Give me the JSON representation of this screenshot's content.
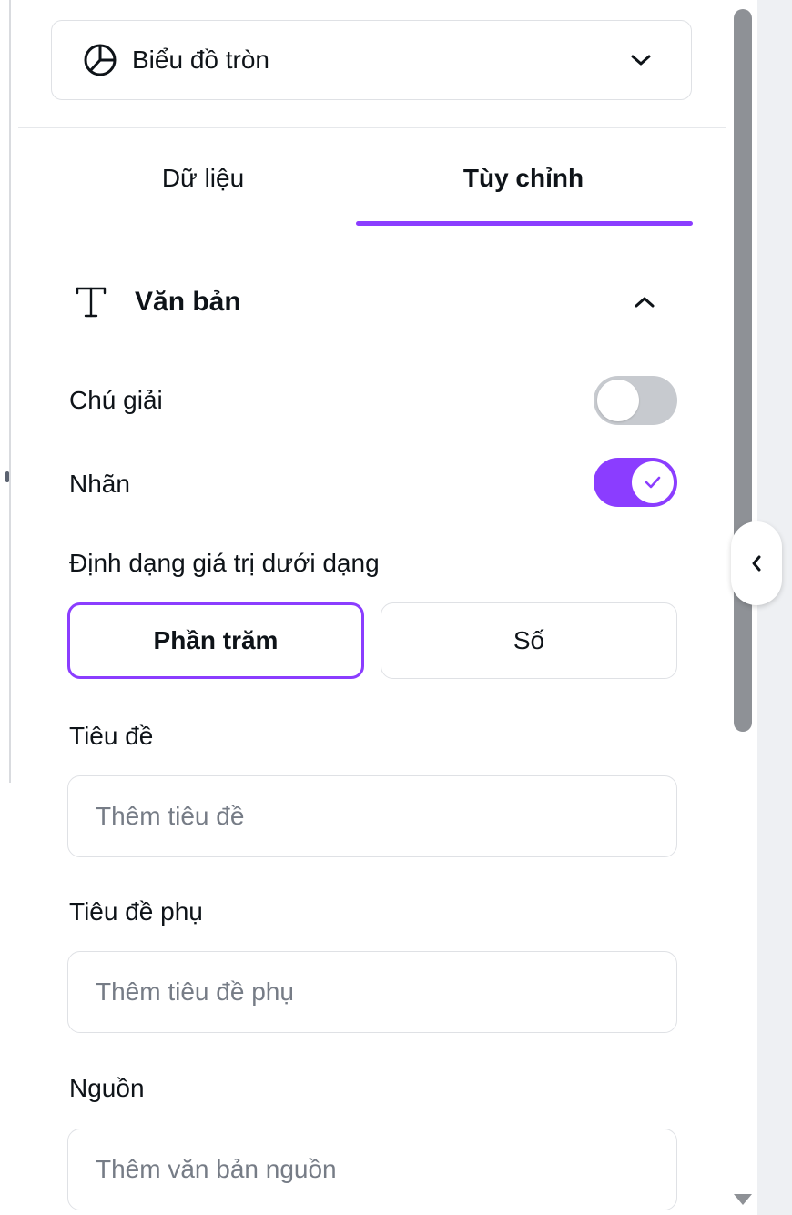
{
  "chart_type_select": {
    "label": "Biểu đồ tròn",
    "icon": "pie-chart-icon",
    "chevron": "chevron-down-icon"
  },
  "tabs": [
    {
      "label": "Dữ liệu",
      "active": false
    },
    {
      "label": "Tùy chỉnh",
      "active": true
    }
  ],
  "section": {
    "title": "Văn bản",
    "icon": "text-t-icon",
    "chevron": "chevron-up-icon"
  },
  "toggles": {
    "legend": {
      "label": "Chú giải",
      "on": false
    },
    "labels": {
      "label": "Nhãn",
      "on": true
    }
  },
  "value_format": {
    "label": "Định dạng giá trị dưới dạng",
    "options": [
      {
        "label": "Phần trăm",
        "selected": true
      },
      {
        "label": "Số",
        "selected": false
      }
    ]
  },
  "fields": {
    "title": {
      "label": "Tiêu đề",
      "value": "",
      "placeholder": "Thêm tiêu đề"
    },
    "subtitle": {
      "label": "Tiêu đề phụ",
      "value": "",
      "placeholder": "Thêm tiêu đề phụ"
    },
    "source": {
      "label": "Nguồn",
      "value": "",
      "placeholder": "Thêm văn bản nguồn"
    }
  },
  "colors": {
    "accent": "#8b3dff",
    "toggle_off": "#c7cacf",
    "border": "#dfe1e5",
    "text": "#0e1318"
  }
}
